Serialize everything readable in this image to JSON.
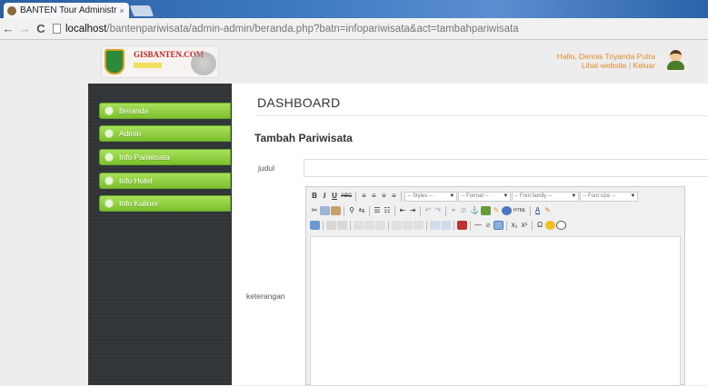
{
  "browser": {
    "tab_title": "BANTEN Tour Administra",
    "tab_close": "×",
    "back": "←",
    "forward": "→",
    "reload": "C",
    "url_host": "localhost",
    "url_path": "/bantenpariwisata/admin-admin/beranda.php?batn=infopariwisata&act=tambahpariwisata"
  },
  "header": {
    "logo_text": "GISBANTEN.COM",
    "greeting": "Hallo, Dennis Triyanda Putra",
    "link_website": "Lihat website",
    "separator": "|",
    "link_logout": "Keluar"
  },
  "sidebar": {
    "items": [
      {
        "label": "Beranda"
      },
      {
        "label": "Admin"
      },
      {
        "label": "Info Pariwisata"
      },
      {
        "label": "Info Hotel"
      },
      {
        "label": "Info Kuliner"
      }
    ]
  },
  "main": {
    "page_title": "DASHBOARD",
    "section_title": "Tambah Pariwisata",
    "field_judul": "judul",
    "field_keterangan": "keterangan"
  },
  "editor": {
    "bold": "B",
    "italic": "I",
    "underline": "U",
    "strike": "ABC",
    "styles": "-- Styles --",
    "format": "-- Format --",
    "font_family": "-- Font family --",
    "font_size": "-- Font size --",
    "dropdown_arrow": "▼",
    "html_btn": "HTML",
    "subscript": "x₁",
    "superscript": "x¹",
    "omega": "Ω",
    "text_color": "A",
    "hr": "—"
  },
  "colors": {
    "accent_green": "#7cc02c",
    "sidebar_dark": "#33373a",
    "link_orange": "#e08a2a"
  }
}
